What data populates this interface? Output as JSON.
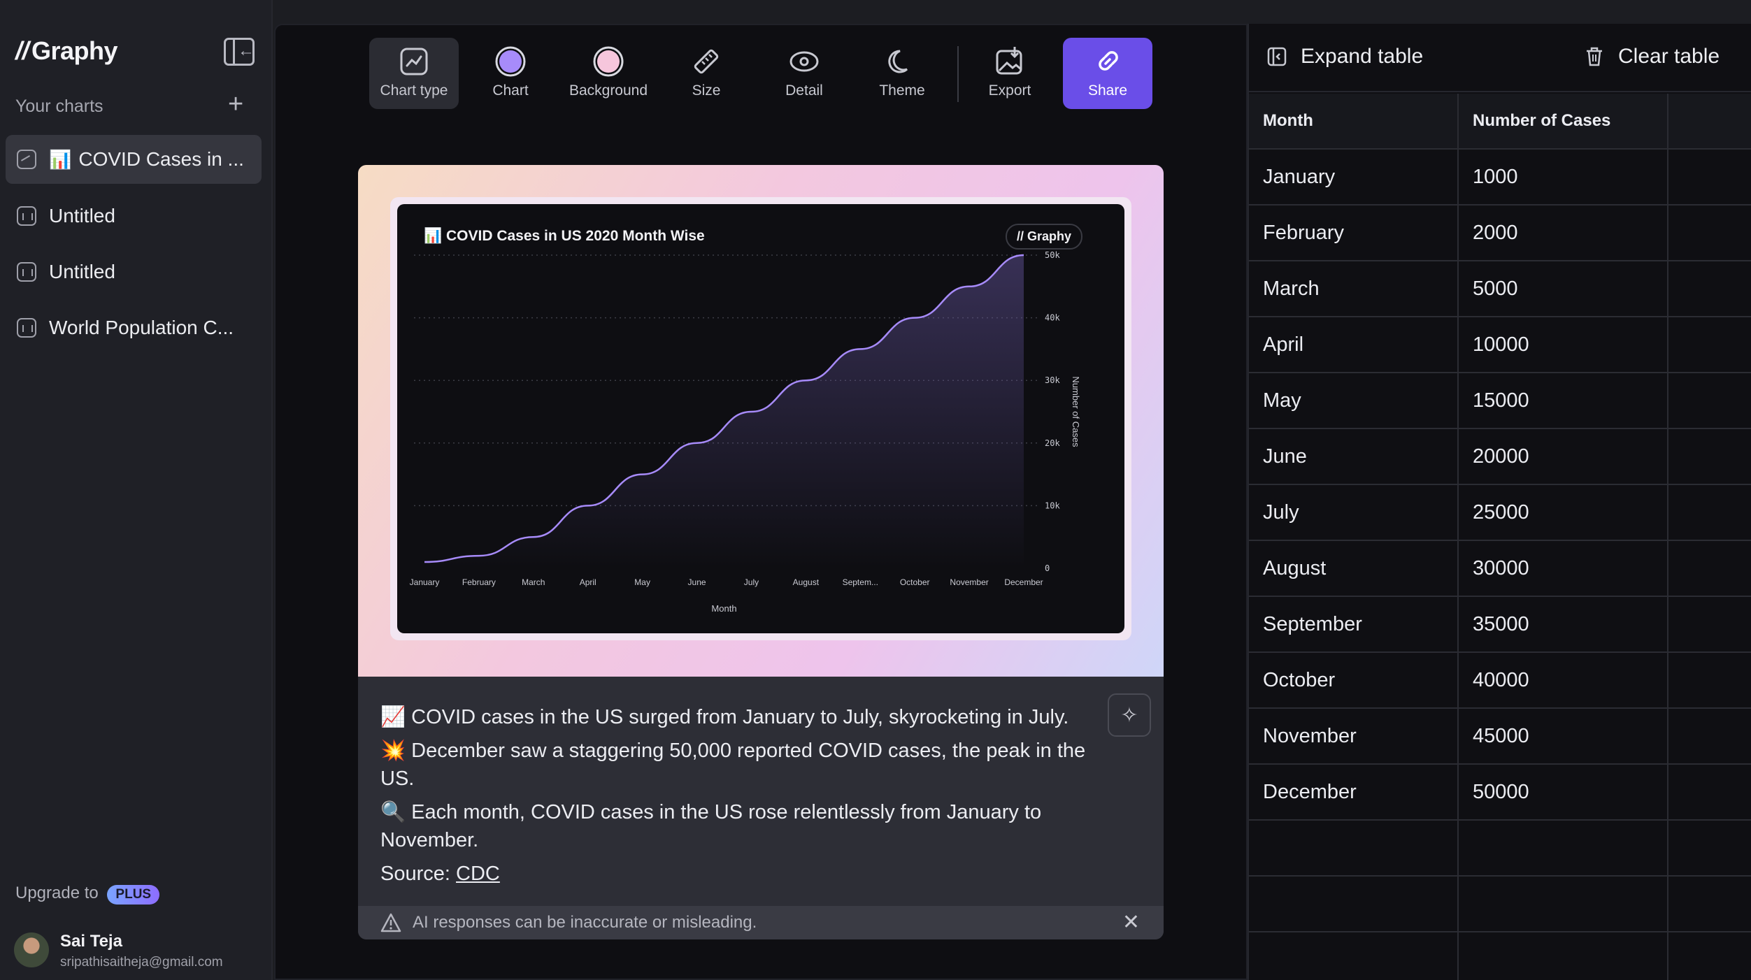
{
  "sidebar": {
    "brand": "Graphy",
    "your_charts_label": "Your charts",
    "add_icon": "plus-icon",
    "items": [
      {
        "label": "COVID Cases in ...",
        "emoji": "📊",
        "active": true
      },
      {
        "label": "Untitled",
        "active": false
      },
      {
        "label": "Untitled",
        "active": false
      },
      {
        "label": "World Population C...",
        "active": false
      }
    ],
    "upgrade_label": "Upgrade to",
    "plus_badge": "PLUS",
    "user": {
      "name": "Sai Teja",
      "email": "sripathisaitheja@gmail.com"
    }
  },
  "toolbar": {
    "chart_type": "Chart type",
    "chart": "Chart",
    "background": "Background",
    "size": "Size",
    "detail": "Detail",
    "theme": "Theme",
    "export": "Export",
    "share": "Share",
    "colors": {
      "chart_swatch": "#a78bfa",
      "background_swatch": "#f6c6dc",
      "share_bg": "#6a4ee8"
    }
  },
  "chart_data": {
    "type": "area",
    "title": "📊 COVID Cases in US 2020 Month Wise",
    "logo": "Graphy",
    "xlabel": "Month",
    "ylabel": "Number of Cases",
    "categories": [
      "January",
      "February",
      "March",
      "April",
      "May",
      "June",
      "July",
      "August",
      "Septem...",
      "October",
      "November",
      "December"
    ],
    "series": [
      {
        "name": "Number of Cases",
        "values": [
          1000,
          2000,
          5000,
          10000,
          15000,
          20000,
          25000,
          30000,
          35000,
          40000,
          45000,
          50000
        ]
      }
    ],
    "y_ticks": [
      "0",
      "10k",
      "20k",
      "30k",
      "40k",
      "50k"
    ],
    "ylim": [
      0,
      50000
    ],
    "y_axis_side": "right",
    "grid": true,
    "line_color": "#a78bfa"
  },
  "insights": {
    "line1": "📈 COVID cases in the US surged from January to July, skyrocketing in July.",
    "line2": "💥 December saw a staggering 50,000 reported COVID cases, the peak in the US.",
    "line3": "🔍 Each month, COVID cases in the US rose relentlessly from January to November.",
    "source_label": "Source:",
    "source_link": "CDC"
  },
  "warning": "AI responses can be inaccurate or misleading.",
  "table_panel": {
    "expand_label": "Expand table",
    "clear_label": "Clear table",
    "columns": [
      "Month",
      "Number of Cases",
      ""
    ],
    "rows": [
      [
        "January",
        "1000"
      ],
      [
        "February",
        "2000"
      ],
      [
        "March",
        "5000"
      ],
      [
        "April",
        "10000"
      ],
      [
        "May",
        "15000"
      ],
      [
        "June",
        "20000"
      ],
      [
        "July",
        "25000"
      ],
      [
        "August",
        "30000"
      ],
      [
        "September",
        "35000"
      ],
      [
        "October",
        "40000"
      ],
      [
        "November",
        "45000"
      ],
      [
        "December",
        "50000"
      ],
      [
        "",
        ""
      ],
      [
        "",
        ""
      ],
      [
        "",
        ""
      ]
    ]
  }
}
